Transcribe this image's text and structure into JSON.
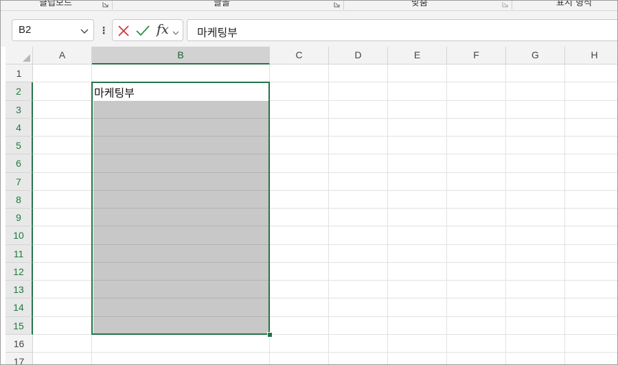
{
  "ribbon": {
    "groups": [
      {
        "label": "클립보드"
      },
      {
        "label": "글꼴"
      },
      {
        "label": "맞춤"
      },
      {
        "label": "표시 형식"
      }
    ]
  },
  "formula_bar": {
    "name_box": "B2",
    "fx_label": "fx",
    "content": "마케팅부"
  },
  "sheet": {
    "columns": [
      "A",
      "B",
      "C",
      "D",
      "E",
      "F",
      "G",
      "H"
    ],
    "rows": [
      "1",
      "2",
      "3",
      "4",
      "5",
      "6",
      "7",
      "8",
      "9",
      "10",
      "11",
      "12",
      "13",
      "14",
      "15",
      "16",
      "17"
    ],
    "selected_column": "B",
    "selected_range": "B2:B15",
    "active_cell": {
      "ref": "B2",
      "value": "마케팅부"
    }
  },
  "colors": {
    "selection": "#217346",
    "fill": "#c8c8c8"
  }
}
